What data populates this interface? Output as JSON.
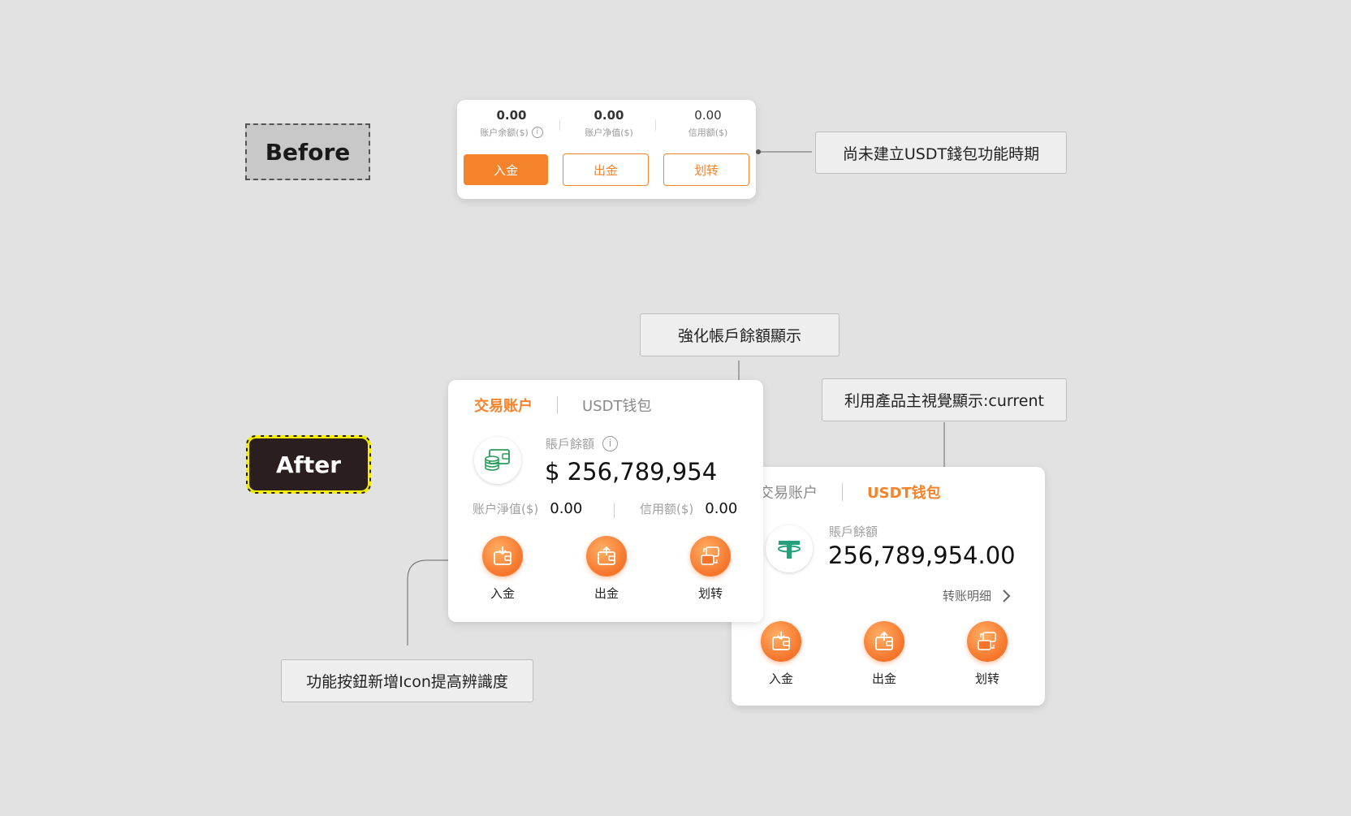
{
  "labels": {
    "before": "Before",
    "after": "After"
  },
  "notes": {
    "before_period": "尚未建立USDT錢包功能時期",
    "balance_highlight": "強化帳戶餘額顯示",
    "visual_current": "利用產品主視覺顯示:current",
    "icon_buttons": "功能按鈕新增Icon提高辨識度"
  },
  "before_card": {
    "stats": [
      {
        "value": "0.00",
        "label": "账户余额($)"
      },
      {
        "value": "0.00",
        "label": "账户净值($)"
      },
      {
        "value": "0.00",
        "label": "信用额($)"
      }
    ],
    "buttons": {
      "deposit": "入金",
      "withdraw": "出金",
      "transfer": "划转"
    }
  },
  "after_card_1": {
    "tabs": {
      "active": "交易账户",
      "inactive": "USDT钱包"
    },
    "balance_label": "賬戶餘額",
    "balance_value": "$ 256,789,954",
    "equity_label": "账户淨值($)",
    "equity_value": "0.00",
    "credit_label": "信用额($)",
    "credit_value": "0.00",
    "actions": {
      "deposit": "入金",
      "withdraw": "出金",
      "transfer": "划转"
    }
  },
  "after_card_2": {
    "tabs": {
      "inactive": "交易账户",
      "active": "USDT钱包"
    },
    "balance_label": "賬戶餘額",
    "balance_value": "256,789,954.00",
    "detail_link": "转账明细",
    "actions": {
      "deposit": "入金",
      "withdraw": "出金",
      "transfer": "划转"
    }
  },
  "colors": {
    "accent": "#f5832b",
    "background": "#e2e2e2",
    "tether": "#26a17b",
    "wallet_green": "#2a9d5c"
  },
  "icons": {
    "info": "info-icon",
    "wallet": "wallet-coins-icon",
    "tether": "tether-icon",
    "deposit": "wallet-deposit-icon",
    "withdraw": "wallet-withdraw-icon",
    "transfer": "wallet-transfer-icon",
    "chevron": "chevron-right-icon"
  }
}
